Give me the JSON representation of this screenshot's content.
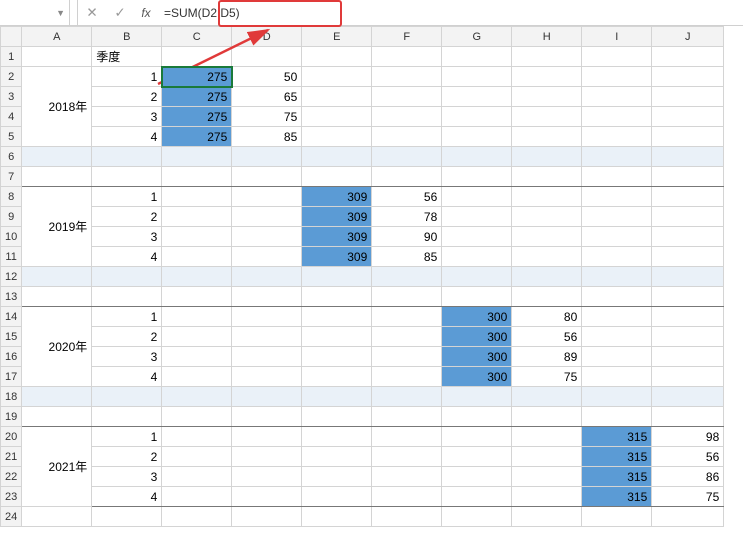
{
  "formula_bar": {
    "name_box": "",
    "cancel": "✕",
    "confirm": "✓",
    "fx": "fx",
    "formula": "=SUM(D2:D5)"
  },
  "columns": [
    "A",
    "B",
    "C",
    "D",
    "E",
    "F",
    "G",
    "H",
    "I",
    "J"
  ],
  "headers": {
    "B1": "季度"
  },
  "years": {
    "y2018": "2018年",
    "y2019": "2019年",
    "y2020": "2020年",
    "y2021": "2021年"
  },
  "quarters": [
    "1",
    "2",
    "3",
    "4"
  ],
  "chart_data": {
    "type": "table",
    "title": "",
    "groups": [
      {
        "year": "2018年",
        "sum_col": "C",
        "detail_col": "D",
        "sum": [
          275,
          275,
          275,
          275
        ],
        "detail": [
          50,
          65,
          75,
          85
        ]
      },
      {
        "year": "2019年",
        "sum_col": "E",
        "detail_col": "F",
        "sum": [
          309,
          309,
          309,
          309
        ],
        "detail": [
          56,
          78,
          90,
          85
        ]
      },
      {
        "year": "2020年",
        "sum_col": "G",
        "detail_col": "H",
        "sum": [
          300,
          300,
          300,
          300
        ],
        "detail": [
          80,
          56,
          89,
          75
        ]
      },
      {
        "year": "2021年",
        "sum_col": "I",
        "detail_col": "J",
        "sum": [
          315,
          315,
          315,
          315
        ],
        "detail": [
          98,
          56,
          86,
          75
        ]
      }
    ]
  },
  "cells": {
    "C2": "275",
    "D2": "50",
    "C3": "275",
    "D3": "65",
    "C4": "275",
    "D4": "75",
    "C5": "275",
    "D5": "85",
    "E8": "309",
    "F8": "56",
    "E9": "309",
    "F9": "78",
    "E10": "309",
    "F10": "90",
    "E11": "309",
    "F11": "85",
    "G14": "300",
    "H14": "80",
    "G15": "300",
    "H15": "56",
    "G16": "300",
    "H16": "89",
    "G17": "300",
    "H17": "75",
    "I20": "315",
    "J20": "98",
    "I21": "315",
    "J21": "56",
    "I22": "315",
    "J22": "86",
    "I23": "315",
    "J23": "75"
  }
}
